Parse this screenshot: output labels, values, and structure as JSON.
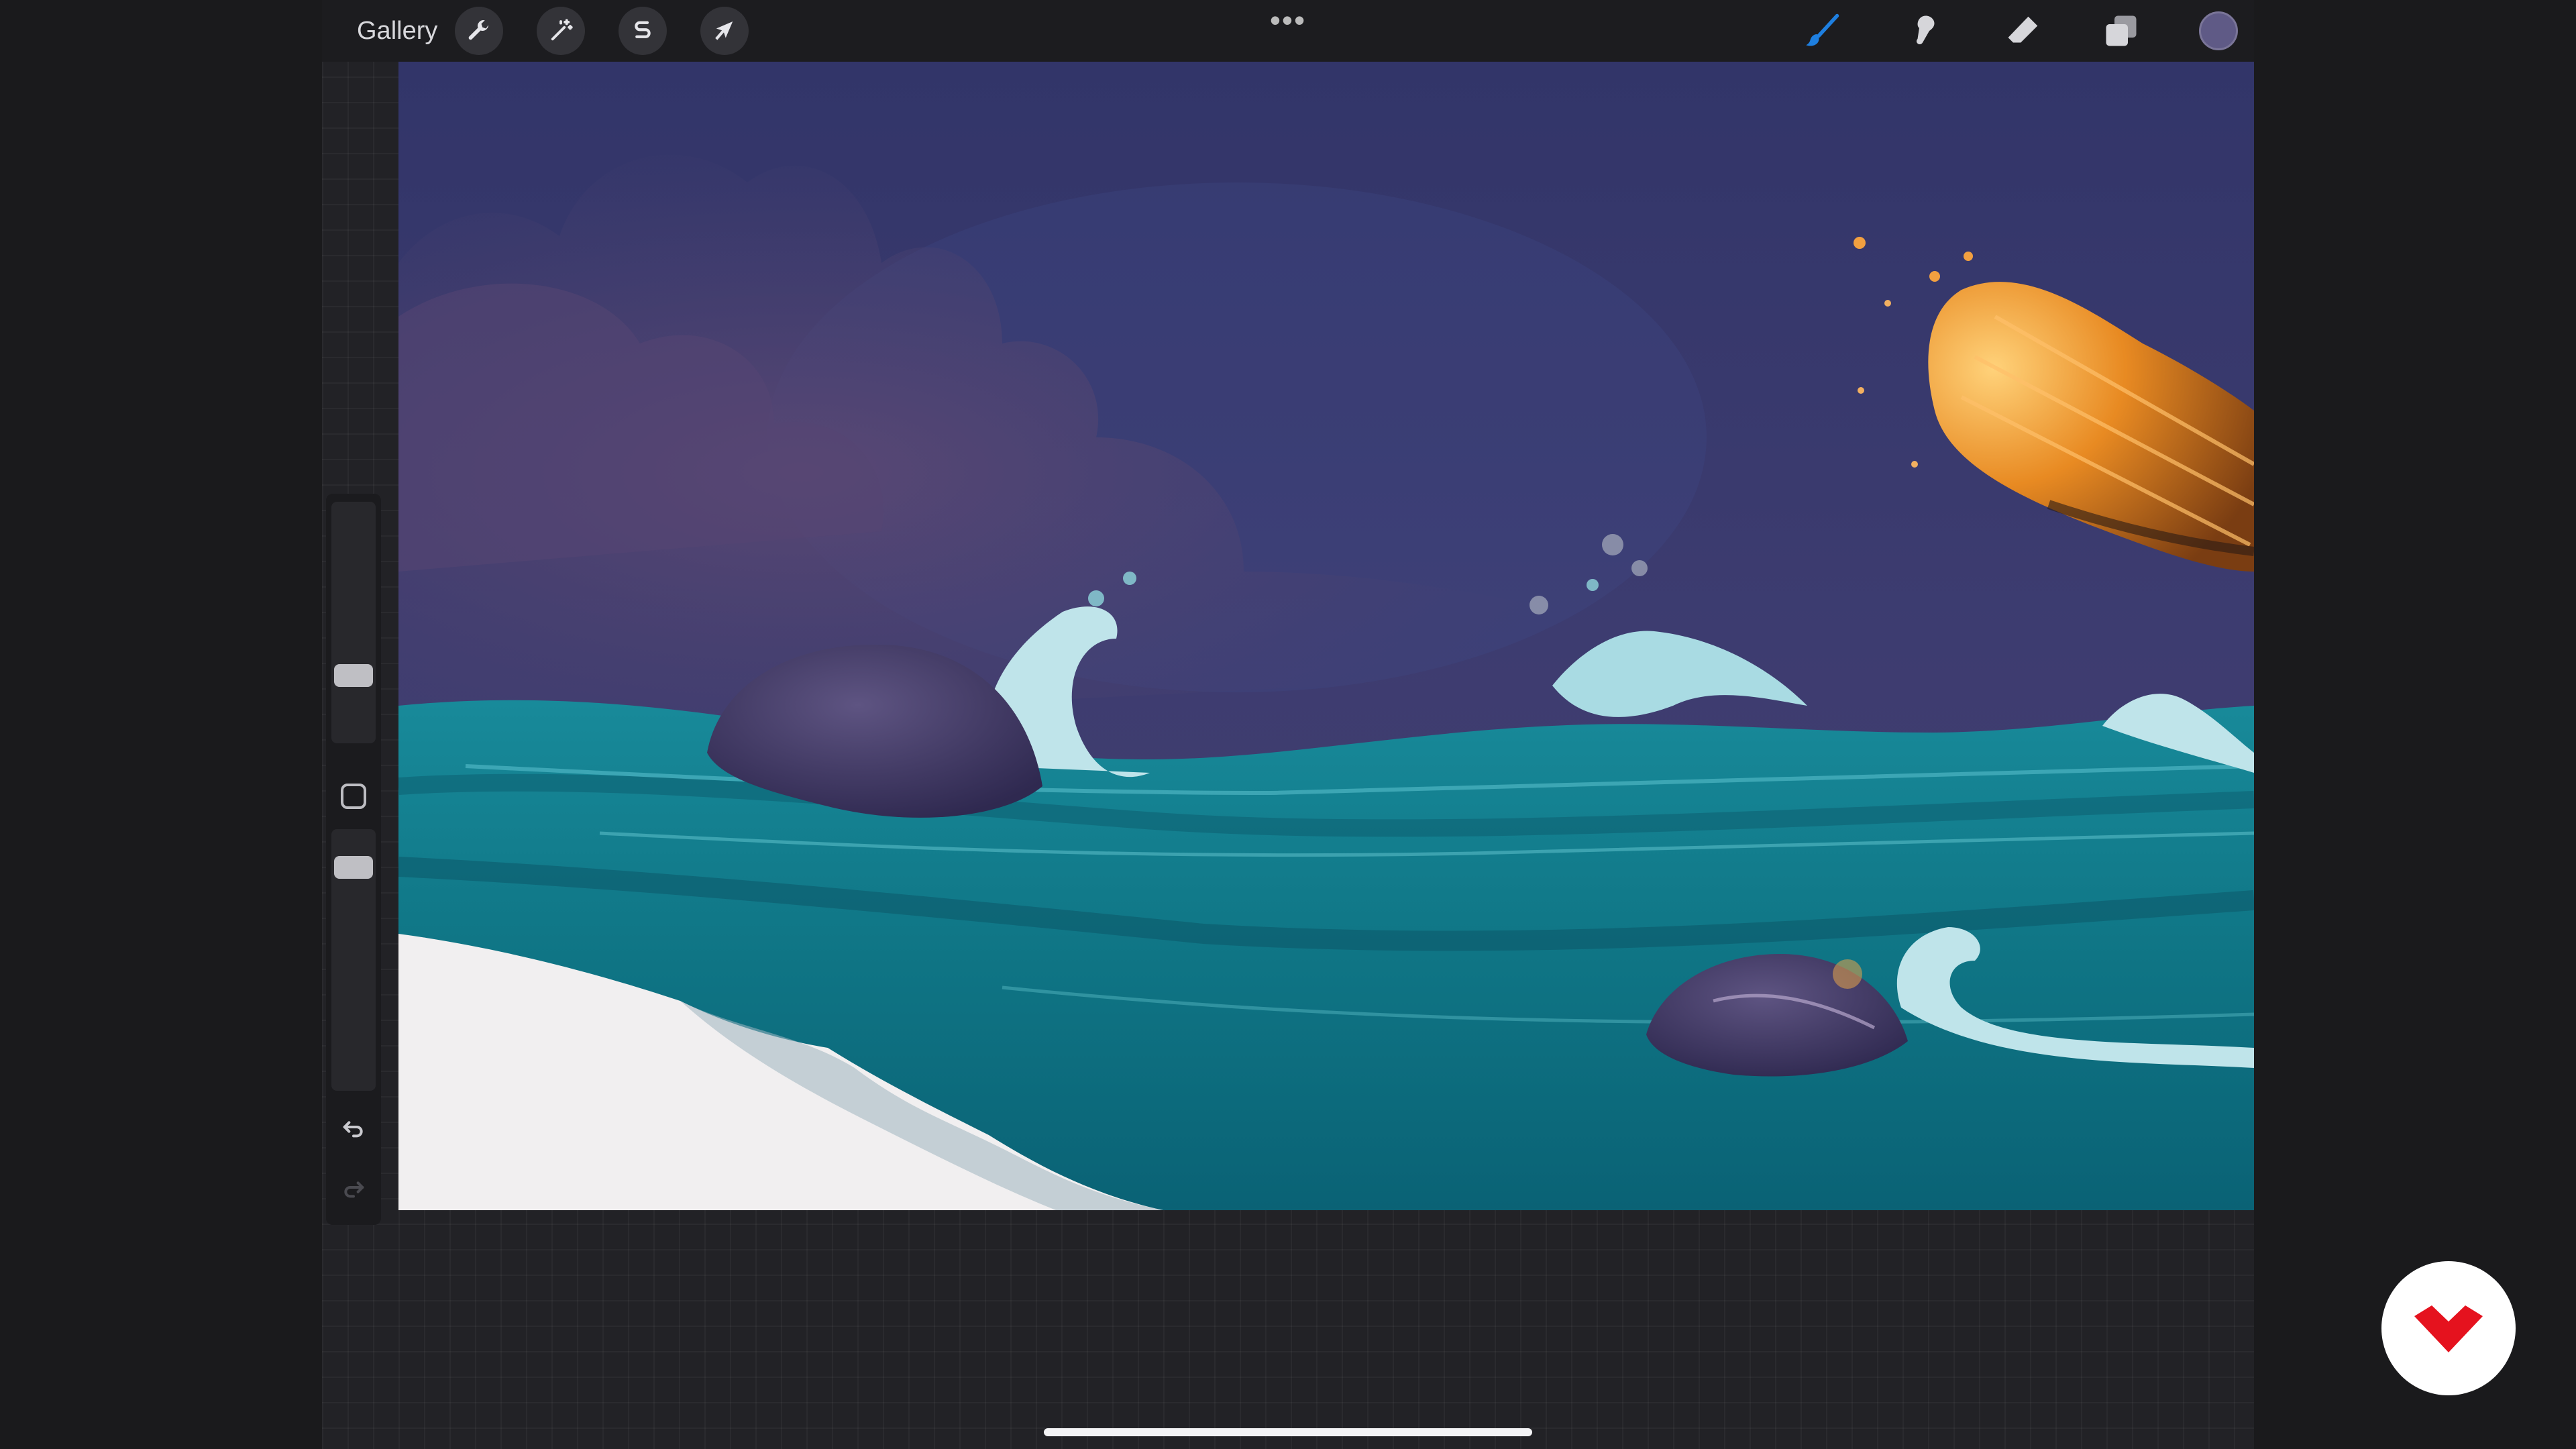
{
  "topbar": {
    "gallery_label": "Gallery",
    "more_label": "•••",
    "left_tools": [
      {
        "name": "actions",
        "icon": "wrench-icon"
      },
      {
        "name": "adjustments",
        "icon": "magic-wand-icon"
      },
      {
        "name": "selection",
        "icon": "selection-s-icon"
      },
      {
        "name": "transform",
        "icon": "arrow-cursor-icon"
      }
    ],
    "right_tools": [
      {
        "name": "brush",
        "icon": "brush-icon",
        "active": true
      },
      {
        "name": "smudge",
        "icon": "smudge-icon"
      },
      {
        "name": "eraser",
        "icon": "eraser-icon"
      },
      {
        "name": "layers",
        "icon": "layers-icon"
      }
    ],
    "current_color": "#5f5a86"
  },
  "sidebar": {
    "brush_size_level": 0.66,
    "opacity_level": 0.9,
    "undo_icon": "undo-icon",
    "redo_icon": "redo-icon",
    "modify_icon": "square-modify-icon"
  },
  "canvas": {
    "description_colors": {
      "sky": "#3c3a6e",
      "cloud": "#4e4272",
      "sea": "#117c8c",
      "foam": "#bfe4ea",
      "rock": "#4a3f6b",
      "paper": "#f1eff0",
      "comet": "#e08a24"
    }
  },
  "brand": {
    "logo_icon": "domestika-logo-icon",
    "logo_color": "#e5121e"
  }
}
